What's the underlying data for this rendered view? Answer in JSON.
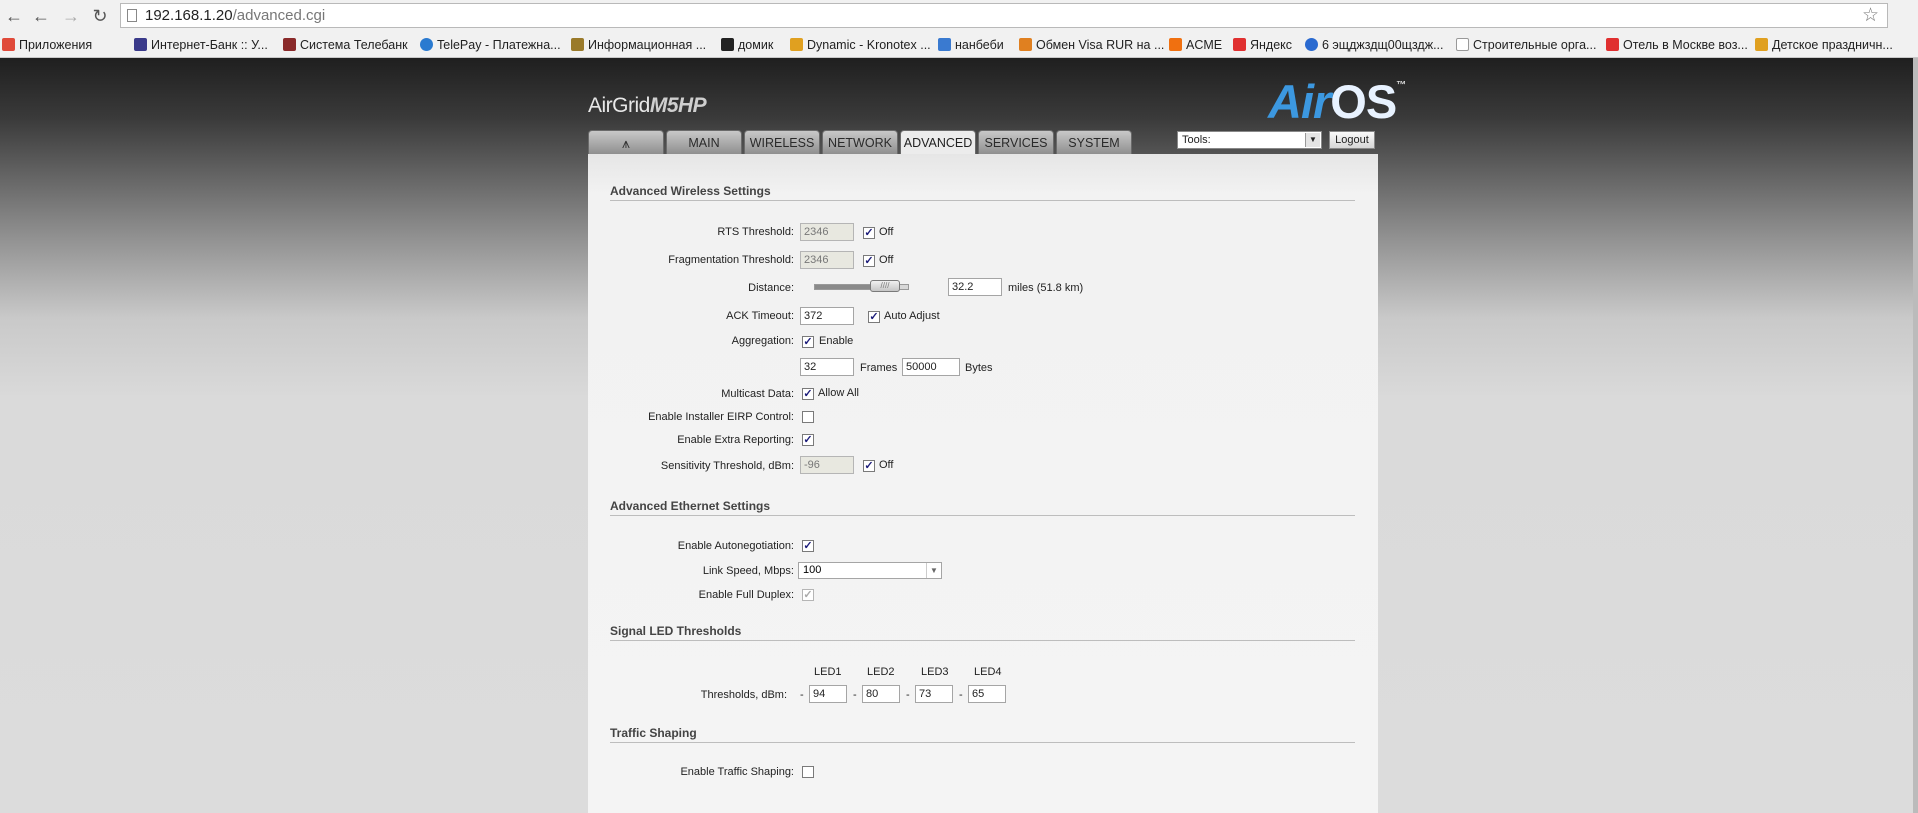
{
  "browser": {
    "url_host": "192.168.1.20",
    "url_path": "/advanced.cgi",
    "bookmarks": [
      {
        "label": "Приложения",
        "color": "#e04a3a"
      },
      {
        "label": "Интернет-Банк :: У...",
        "color": "#3a3a8a"
      },
      {
        "label": "Система Телебанк",
        "color": "#8a2a2a"
      },
      {
        "label": "TelePay - Платежна...",
        "color": "#2a7ad0"
      },
      {
        "label": "Информационная ...",
        "color": "#9a7a2a"
      },
      {
        "label": "домик",
        "color": "#222222"
      },
      {
        "label": "Dynamic - Kronotex ...",
        "color": "#e0a020"
      },
      {
        "label": "нанбеби",
        "color": "#3a7ad0"
      },
      {
        "label": "Обмен Visa RUR на ...",
        "color": "#e08020"
      },
      {
        "label": "ACME",
        "color": "#f07010"
      },
      {
        "label": "Яндекс",
        "color": "#e03030"
      },
      {
        "label": "6 эщджздщ00щздж...",
        "color": "#2a6ad0"
      },
      {
        "label": "Строительные орга...",
        "color": "#bbbbbb"
      },
      {
        "label": "Отель в Москве воз...",
        "color": "#e03030"
      },
      {
        "label": "Детское праздничн...",
        "color": "#e0a020"
      }
    ]
  },
  "header": {
    "product_prefix": "AirGrid",
    "product_model": "M5HP",
    "airos_air": "Air",
    "airos_os": "OS",
    "airos_tm": "™"
  },
  "tabs": [
    {
      "label": "MAIN"
    },
    {
      "label": "WIRELESS"
    },
    {
      "label": "NETWORK"
    },
    {
      "label": "ADVANCED"
    },
    {
      "label": "SERVICES"
    },
    {
      "label": "SYSTEM"
    }
  ],
  "tools": {
    "selected": "Tools:",
    "logout_label": "Logout"
  },
  "wireless": {
    "title": "Advanced Wireless Settings",
    "rts_label": "RTS Threshold:",
    "rts_value": "2346",
    "rts_off_label": "Off",
    "frag_label": "Fragmentation Threshold:",
    "frag_value": "2346",
    "frag_off_label": "Off",
    "distance_label": "Distance:",
    "distance_value": "32.2",
    "distance_unit": "miles (51.8 km)",
    "distance_slider_fraction": 0.85,
    "ack_label": "ACK Timeout:",
    "ack_value": "372",
    "ack_auto_label": "Auto Adjust",
    "aggregation_label": "Aggregation:",
    "aggregation_enable_label": "Enable",
    "frames_value": "32",
    "frames_label": "Frames",
    "bytes_value": "50000",
    "bytes_label": "Bytes",
    "multicast_label": "Multicast Data:",
    "multicast_allow_label": "Allow All",
    "eirp_label": "Enable Installer EIRP Control:",
    "extra_reporting_label": "Enable Extra Reporting:",
    "sensitivity_label": "Sensitivity Threshold, dBm:",
    "sensitivity_value": "-96",
    "sensitivity_off_label": "Off"
  },
  "ethernet": {
    "title": "Advanced Ethernet Settings",
    "autoneg_label": "Enable Autonegotiation:",
    "link_speed_label": "Link Speed, Mbps:",
    "link_speed_value": "100",
    "full_duplex_label": "Enable Full Duplex:"
  },
  "led": {
    "title": "Signal LED Thresholds",
    "thresholds_label": "Thresholds, dBm:",
    "led1_label": "LED1",
    "led2_label": "LED2",
    "led3_label": "LED3",
    "led4_label": "LED4",
    "led1_value": "94",
    "led2_value": "80",
    "led3_value": "73",
    "led4_value": "65",
    "dash": "-"
  },
  "traffic": {
    "title": "Traffic Shaping",
    "enable_label": "Enable Traffic Shaping:"
  },
  "checks": {
    "rts_off": true,
    "frag_off": true,
    "ack_auto": true,
    "aggregation": true,
    "multicast": true,
    "eirp": false,
    "extra_reporting": true,
    "sensitivity_off": true,
    "autoneg": true,
    "full_duplex": true,
    "traffic_shaping": false
  }
}
